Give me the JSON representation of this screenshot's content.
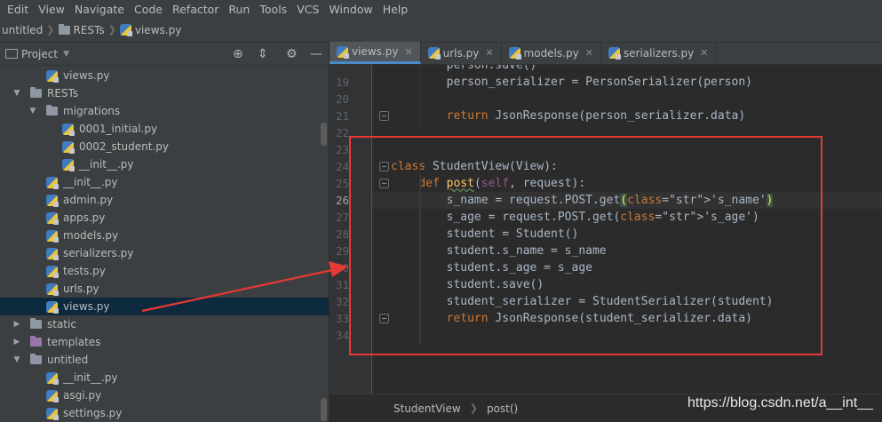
{
  "menu": [
    "Edit",
    "View",
    "Navigate",
    "Code",
    "Refactor",
    "Run",
    "Tools",
    "VCS",
    "Window",
    "Help"
  ],
  "breadcrumb": [
    "untitled",
    "RESTs",
    "views.py"
  ],
  "project_panel": {
    "title": "Project",
    "tree": [
      {
        "label": "views.py",
        "type": "py",
        "indent": 2
      },
      {
        "label": "RESTs",
        "type": "folder",
        "indent": 1,
        "expanded": true
      },
      {
        "label": "migrations",
        "type": "folder",
        "indent": 2,
        "expanded": true
      },
      {
        "label": "0001_initial.py",
        "type": "py",
        "indent": 3
      },
      {
        "label": "0002_student.py",
        "type": "py",
        "indent": 3
      },
      {
        "label": "__init__.py",
        "type": "py",
        "indent": 3
      },
      {
        "label": "__init__.py",
        "type": "py",
        "indent": 2
      },
      {
        "label": "admin.py",
        "type": "py",
        "indent": 2
      },
      {
        "label": "apps.py",
        "type": "py",
        "indent": 2
      },
      {
        "label": "models.py",
        "type": "py",
        "indent": 2
      },
      {
        "label": "serializers.py",
        "type": "py",
        "indent": 2
      },
      {
        "label": "tests.py",
        "type": "py",
        "indent": 2
      },
      {
        "label": "urls.py",
        "type": "py",
        "indent": 2
      },
      {
        "label": "views.py",
        "type": "py",
        "indent": 2,
        "selected": true
      },
      {
        "label": "static",
        "type": "folder",
        "indent": 1,
        "expanded": false
      },
      {
        "label": "templates",
        "type": "folder-purple",
        "indent": 1,
        "expanded": false
      },
      {
        "label": "untitled",
        "type": "folder",
        "indent": 1,
        "expanded": true
      },
      {
        "label": "__init__.py",
        "type": "py",
        "indent": 2
      },
      {
        "label": "asgi.py",
        "type": "py",
        "indent": 2
      },
      {
        "label": "settings.py",
        "type": "py",
        "indent": 2
      }
    ]
  },
  "tabs": [
    {
      "label": "views.py",
      "active": true
    },
    {
      "label": "urls.py",
      "active": false
    },
    {
      "label": "models.py",
      "active": false
    },
    {
      "label": "serializers.py",
      "active": false
    }
  ],
  "editor": {
    "first_partial_line": "        person.save()",
    "lines": [
      {
        "num": "19",
        "text": "        person_serializer = PersonSerializer(person)"
      },
      {
        "num": "20",
        "text": ""
      },
      {
        "num": "21",
        "text": "        return JsonResponse(person_serializer.data)"
      },
      {
        "num": "22",
        "text": ""
      },
      {
        "num": "23",
        "text": ""
      },
      {
        "num": "24",
        "text": "class StudentView(View):"
      },
      {
        "num": "25",
        "text": "    def post(self, request):"
      },
      {
        "num": "26",
        "text": "        s_name = request.POST.get('s_name')"
      },
      {
        "num": "27",
        "text": "        s_age = request.POST.get('s_age')"
      },
      {
        "num": "28",
        "text": "        student = Student()"
      },
      {
        "num": "29",
        "text": "        student.s_name = s_name"
      },
      {
        "num": "30",
        "text": "        student.s_age = s_age"
      },
      {
        "num": "31",
        "text": "        student.save()"
      },
      {
        "num": "32",
        "text": "        student_serializer = StudentSerializer(student)"
      },
      {
        "num": "33",
        "text": "        return JsonResponse(student_serializer.data)"
      },
      {
        "num": "34",
        "text": ""
      }
    ]
  },
  "editor_breadcrumb": [
    "StudentView",
    "post()"
  ],
  "watermark": "https://blog.csdn.net/a__int__",
  "colors": {
    "annotation": "#e53935",
    "selection": "#0d293e",
    "tab_accent": "#4a88c7"
  }
}
